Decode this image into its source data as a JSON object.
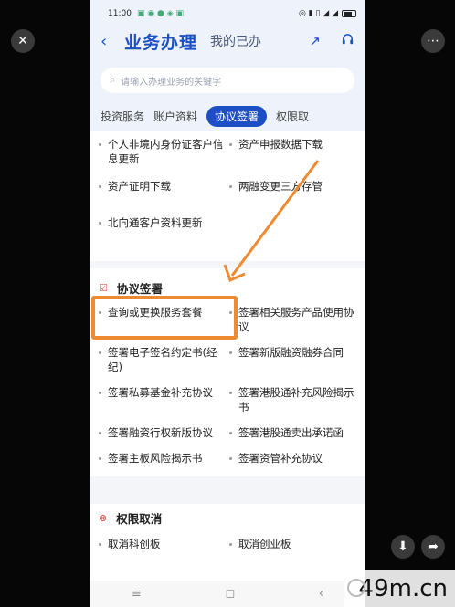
{
  "status": {
    "time": "11:00",
    "icons_left": "▣ ◉ ● ◈ ▣",
    "icons_right": "◎ ▮ ▯ ◢ ◢"
  },
  "header": {
    "back_icon": "‹",
    "title": "业务办理",
    "subtitle": "我的已办",
    "share_icon": "↗",
    "service_icon": "🎧"
  },
  "search": {
    "placeholder": "请输入办理业务的关键字"
  },
  "tabs": [
    "投资服务",
    "账户资料",
    "协议签署",
    "权限取"
  ],
  "active_tab": "协议签署",
  "account_items": [
    [
      "个人非境内身份证客户信息更新",
      "资产申报数据下载"
    ],
    [
      "资产证明下载",
      "两融变更三方存管"
    ],
    [
      "北向通客户资料更新",
      ""
    ]
  ],
  "sections": {
    "agreement": {
      "title": "协议签署",
      "icon": "☑"
    },
    "revoke": {
      "title": "权限取消",
      "icon": "⊗"
    }
  },
  "agreement_items": [
    [
      "查询或更换服务套餐",
      "签署相关服务产品使用协议"
    ],
    [
      "签署电子签名约定书(经纪)",
      "签署新版融资融券合同"
    ],
    [
      "签署私募基金补充协议",
      "签署港股通补充风险揭示书"
    ],
    [
      "签署融资行权新版协议",
      "签署港股通卖出承诺函"
    ],
    [
      "签署主板风险揭示书",
      "签署资管补充协议"
    ]
  ],
  "revoke_items": [
    [
      "取消科创板",
      "取消创业板"
    ]
  ],
  "navbar": {
    "menu": "≡",
    "home": "◻",
    "back": "‹"
  },
  "viewer": {
    "close": "✕",
    "more": "⋯",
    "download": "⬇",
    "share": "➦"
  },
  "watermark": "49m.cn",
  "colors": {
    "brand_blue": "#1d4fc4",
    "highlight_orange": "#f08a32",
    "section_red": "#e05a4f"
  }
}
